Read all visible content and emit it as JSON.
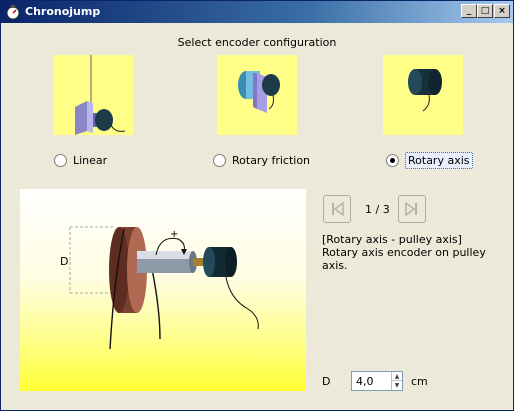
{
  "window": {
    "title": "Chronojump"
  },
  "heading": "Select encoder configuration",
  "options": [
    {
      "label": "Linear",
      "selected": false
    },
    {
      "label": "Rotary friction",
      "selected": false
    },
    {
      "label": "Rotary axis",
      "selected": true
    }
  ],
  "navigation": {
    "counter": "1 / 3"
  },
  "description": {
    "title": "[Rotary axis - pulley axis]",
    "body": "Rotary axis encoder on pulley axis."
  },
  "diagram": {
    "d_label": "D",
    "plus_label": "+"
  },
  "parameter": {
    "label": "D",
    "value": "4,0",
    "unit": "cm"
  },
  "colors": {
    "thumbnail_bg": "#ffff88",
    "titlebar": "#0a246a"
  }
}
